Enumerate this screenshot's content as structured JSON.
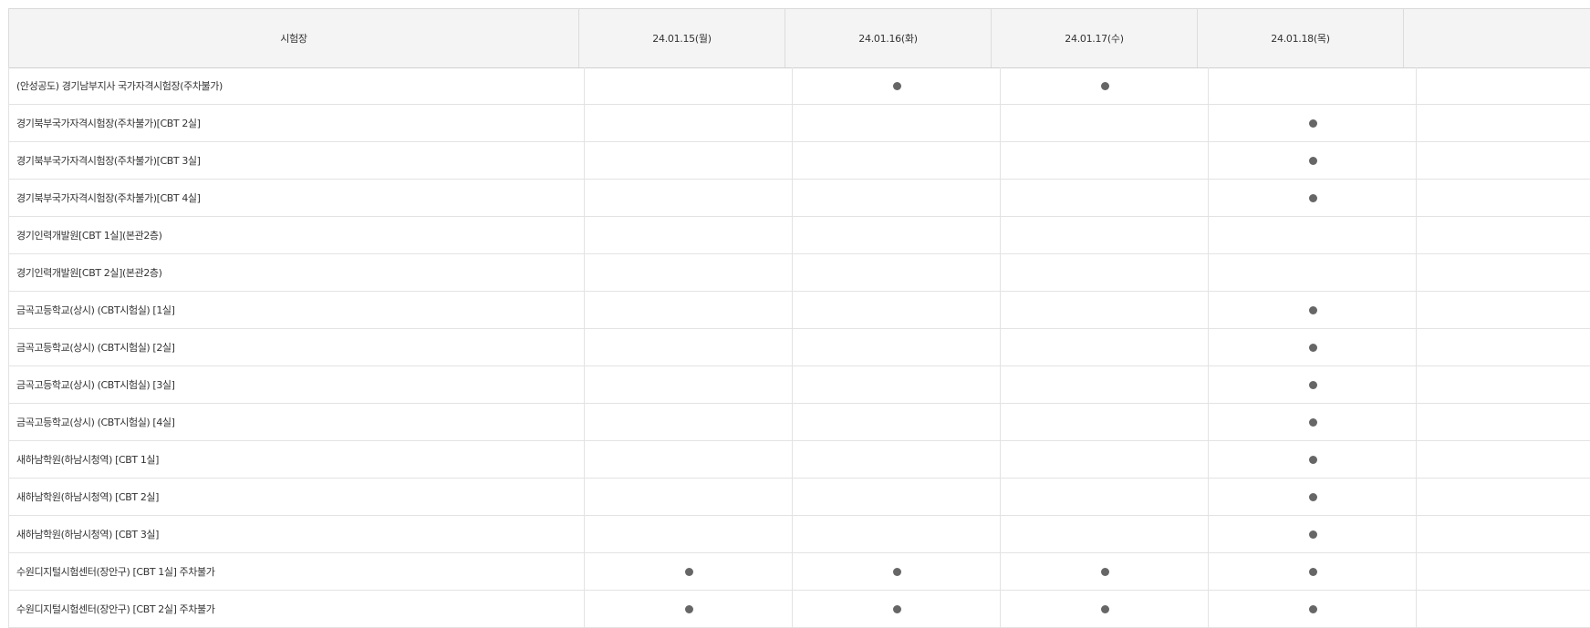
{
  "table": {
    "headers": {
      "venue": "시험장",
      "dates": [
        "24.01.15(월)",
        "24.01.16(화)",
        "24.01.17(수)",
        "24.01.18(목)",
        ""
      ]
    },
    "available_mark": "●",
    "rows": [
      {
        "name": "(안성공도) 경기남부지사 국가자격시험장(주차불가)",
        "days": [
          false,
          true,
          true,
          false,
          false
        ]
      },
      {
        "name": "경기북부국가자격시험장(주차불가)[CBT 2실]",
        "days": [
          false,
          false,
          false,
          true,
          false
        ]
      },
      {
        "name": "경기북부국가자격시험장(주차불가)[CBT 3실]",
        "days": [
          false,
          false,
          false,
          true,
          false
        ]
      },
      {
        "name": "경기북부국가자격시험장(주차불가)[CBT 4실]",
        "days": [
          false,
          false,
          false,
          true,
          false
        ]
      },
      {
        "name": "경기인력개발원[CBT 1실](본관2층)",
        "days": [
          false,
          false,
          false,
          false,
          false
        ]
      },
      {
        "name": "경기인력개발원[CBT 2실](본관2층)",
        "days": [
          false,
          false,
          false,
          false,
          false
        ]
      },
      {
        "name": "금곡고등학교(상시) (CBT시험실) [1실]",
        "days": [
          false,
          false,
          false,
          true,
          false
        ]
      },
      {
        "name": "금곡고등학교(상시) (CBT시험실) [2실]",
        "days": [
          false,
          false,
          false,
          true,
          false
        ]
      },
      {
        "name": "금곡고등학교(상시) (CBT시험실) [3실]",
        "days": [
          false,
          false,
          false,
          true,
          false
        ]
      },
      {
        "name": "금곡고등학교(상시) (CBT시험실) [4실]",
        "days": [
          false,
          false,
          false,
          true,
          false
        ]
      },
      {
        "name": "새하남학원(하남시청역) [CBT 1실]",
        "days": [
          false,
          false,
          false,
          true,
          false
        ]
      },
      {
        "name": "새하남학원(하남시청역) [CBT 2실]",
        "days": [
          false,
          false,
          false,
          true,
          false
        ]
      },
      {
        "name": "새하남학원(하남시청역) [CBT 3실]",
        "days": [
          false,
          false,
          false,
          true,
          false
        ]
      },
      {
        "name": "수원디지털시험센터(장안구) [CBT 1실] 주차불가",
        "days": [
          true,
          true,
          true,
          true,
          false
        ]
      },
      {
        "name": "수원디지털시험센터(장안구) [CBT 2실] 주차불가",
        "days": [
          true,
          true,
          true,
          true,
          false
        ]
      }
    ]
  },
  "colors": {
    "header_bg": "#f4f4f4",
    "border": "#e3e3e3",
    "dot": "#666666",
    "text": "#333333"
  }
}
